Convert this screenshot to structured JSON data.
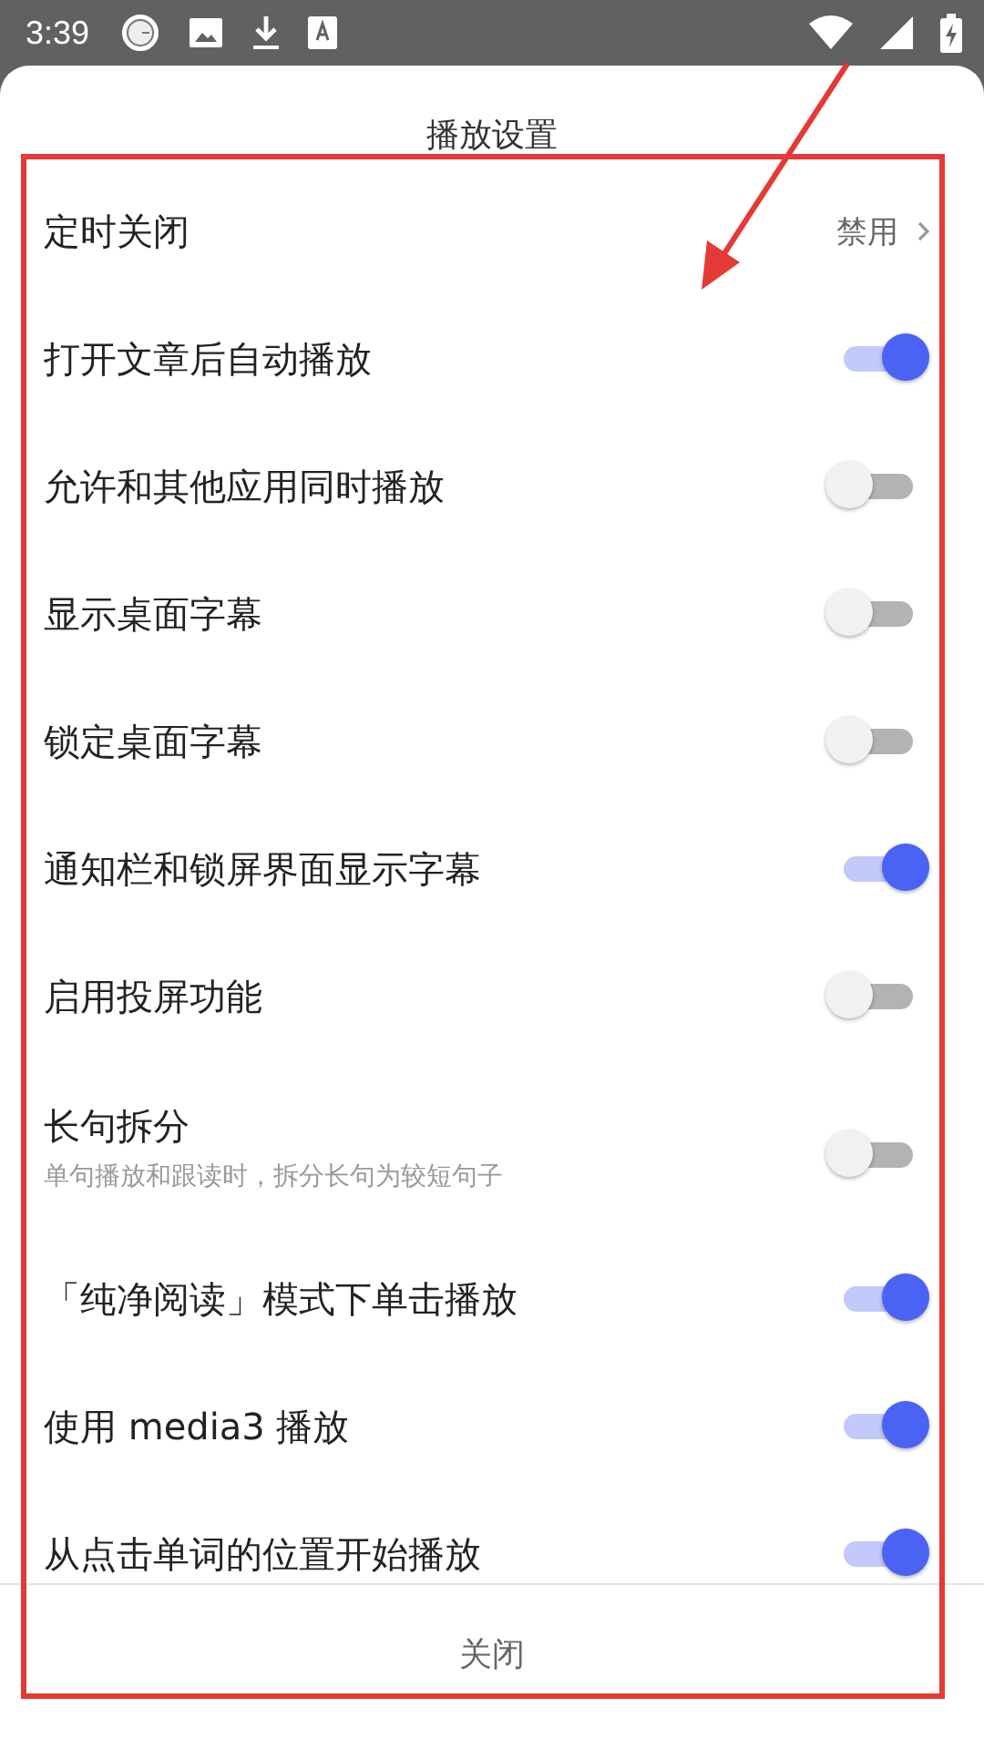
{
  "status_bar": {
    "time": "3:39"
  },
  "title": "播放设置",
  "settings": [
    {
      "kind": "link",
      "label": "定时关闭",
      "value": "禁用"
    },
    {
      "kind": "toggle",
      "label": "打开文章后自动播放",
      "on": true
    },
    {
      "kind": "toggle",
      "label": "允许和其他应用同时播放",
      "on": false
    },
    {
      "kind": "toggle",
      "label": "显示桌面字幕",
      "on": false
    },
    {
      "kind": "toggle",
      "label": "锁定桌面字幕",
      "on": false
    },
    {
      "kind": "toggle",
      "label": "通知栏和锁屏界面显示字幕",
      "on": true
    },
    {
      "kind": "toggle",
      "label": "启用投屏功能",
      "on": false
    },
    {
      "kind": "toggle",
      "label": "长句拆分",
      "subtitle": "单句播放和跟读时，拆分长句为较短句子",
      "on": false
    },
    {
      "kind": "toggle",
      "label": "「纯净阅读」模式下单击播放",
      "on": true
    },
    {
      "kind": "toggle",
      "label": "使用 media3 播放",
      "on": true
    },
    {
      "kind": "toggle",
      "label": "从点击单词的位置开始播放",
      "on": true
    }
  ],
  "close_button": "关闭"
}
